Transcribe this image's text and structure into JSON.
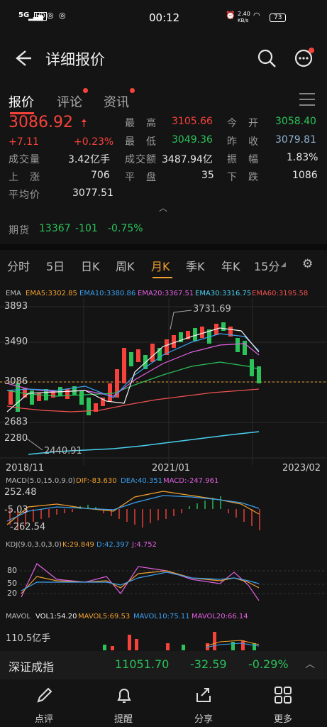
{
  "status": {
    "network": "5G",
    "time": "00:12",
    "speed_val": "2.40",
    "speed_unit": "KB/s",
    "battery": "73"
  },
  "nav": {
    "title": "详细报价"
  },
  "tabs": {
    "quote": "报价",
    "comment": "评论",
    "news": "资讯"
  },
  "quote": {
    "price": "3086.92",
    "change": "+7.11",
    "pct": "+0.23%",
    "high_label": "最　高",
    "high": "3105.66",
    "open_label": "今　开",
    "open": "3058.40",
    "low_label": "最　低",
    "low": "3049.36",
    "prev_label": "昨　收",
    "prev": "3079.81",
    "vol_label": "成交量",
    "vol": "3.42亿手",
    "amt_label": "成交额",
    "amt": "3487.94亿",
    "amp_label": "振　幅",
    "amp": "1.83%",
    "up_label": "上　涨",
    "up": "706",
    "flat_label": "平　盘",
    "flat": "35",
    "down_label": "下　跌",
    "down": "1086",
    "avg_label": "平均价",
    "avg": "3077.51"
  },
  "futures": {
    "label": "期货",
    "value": "13367",
    "change": "-101",
    "pct": "-0.75%"
  },
  "ktabs": [
    "分时",
    "5日",
    "日K",
    "周K",
    "月K",
    "季K",
    "年K",
    "15分"
  ],
  "ktabs_active": 4,
  "ema": {
    "label": "EMA",
    "ema5": "EMA5:3302.85",
    "ema10": "EMA10:3380.86",
    "ema20": "EMA20:3367.51",
    "ema30": "EMA30:3316.75",
    "ema60": "EMA60:3195.58"
  },
  "colors": {
    "ema5": "#f0a030",
    "ema10": "#3aa0f0",
    "ema20": "#e060e0",
    "ema30": "#4ad0f0",
    "ema60": "#f05050",
    "red": "#f5433b",
    "green": "#2ac35a"
  },
  "kaxis": {
    "y1": "3893",
    "y2": "3490",
    "y3": "3086",
    "y4": "2683",
    "y5": "2280",
    "max_note": "3731.69",
    "min_note": "2440.91",
    "x1": "2018/11",
    "x2": "2021/01",
    "x3": "2023/02"
  },
  "macd": {
    "label": "MACD(5.0,15.0,9.0)",
    "dif": "DIF:-83.630",
    "dea": "DEA:40.351",
    "macd": "MACD:-247.961",
    "y1": "252.48",
    "y2": "-5.03",
    "y3": "-262.54"
  },
  "kdj": {
    "label": "KDJ(9.0,3.0,3.0)",
    "k": "K:29.849",
    "d": "D:42.397",
    "j": "J:4.752",
    "y1": "80",
    "y2": "50",
    "y3": "20"
  },
  "mavol": {
    "label": "MAVOL",
    "vol1": "VOL1:54.20",
    "ma5": "MAVOL5:69.53",
    "ma10": "MAVOL10:75.11",
    "ma20": "MAVOL20:66.14",
    "y1": "110.5亿手"
  },
  "index": {
    "name": "深证成指",
    "value": "11051.70",
    "change": "-32.59",
    "pct": "-0.29%"
  },
  "toolbar": {
    "comment": "点评",
    "alert": "提醒",
    "share": "分享",
    "more": "更多"
  }
}
